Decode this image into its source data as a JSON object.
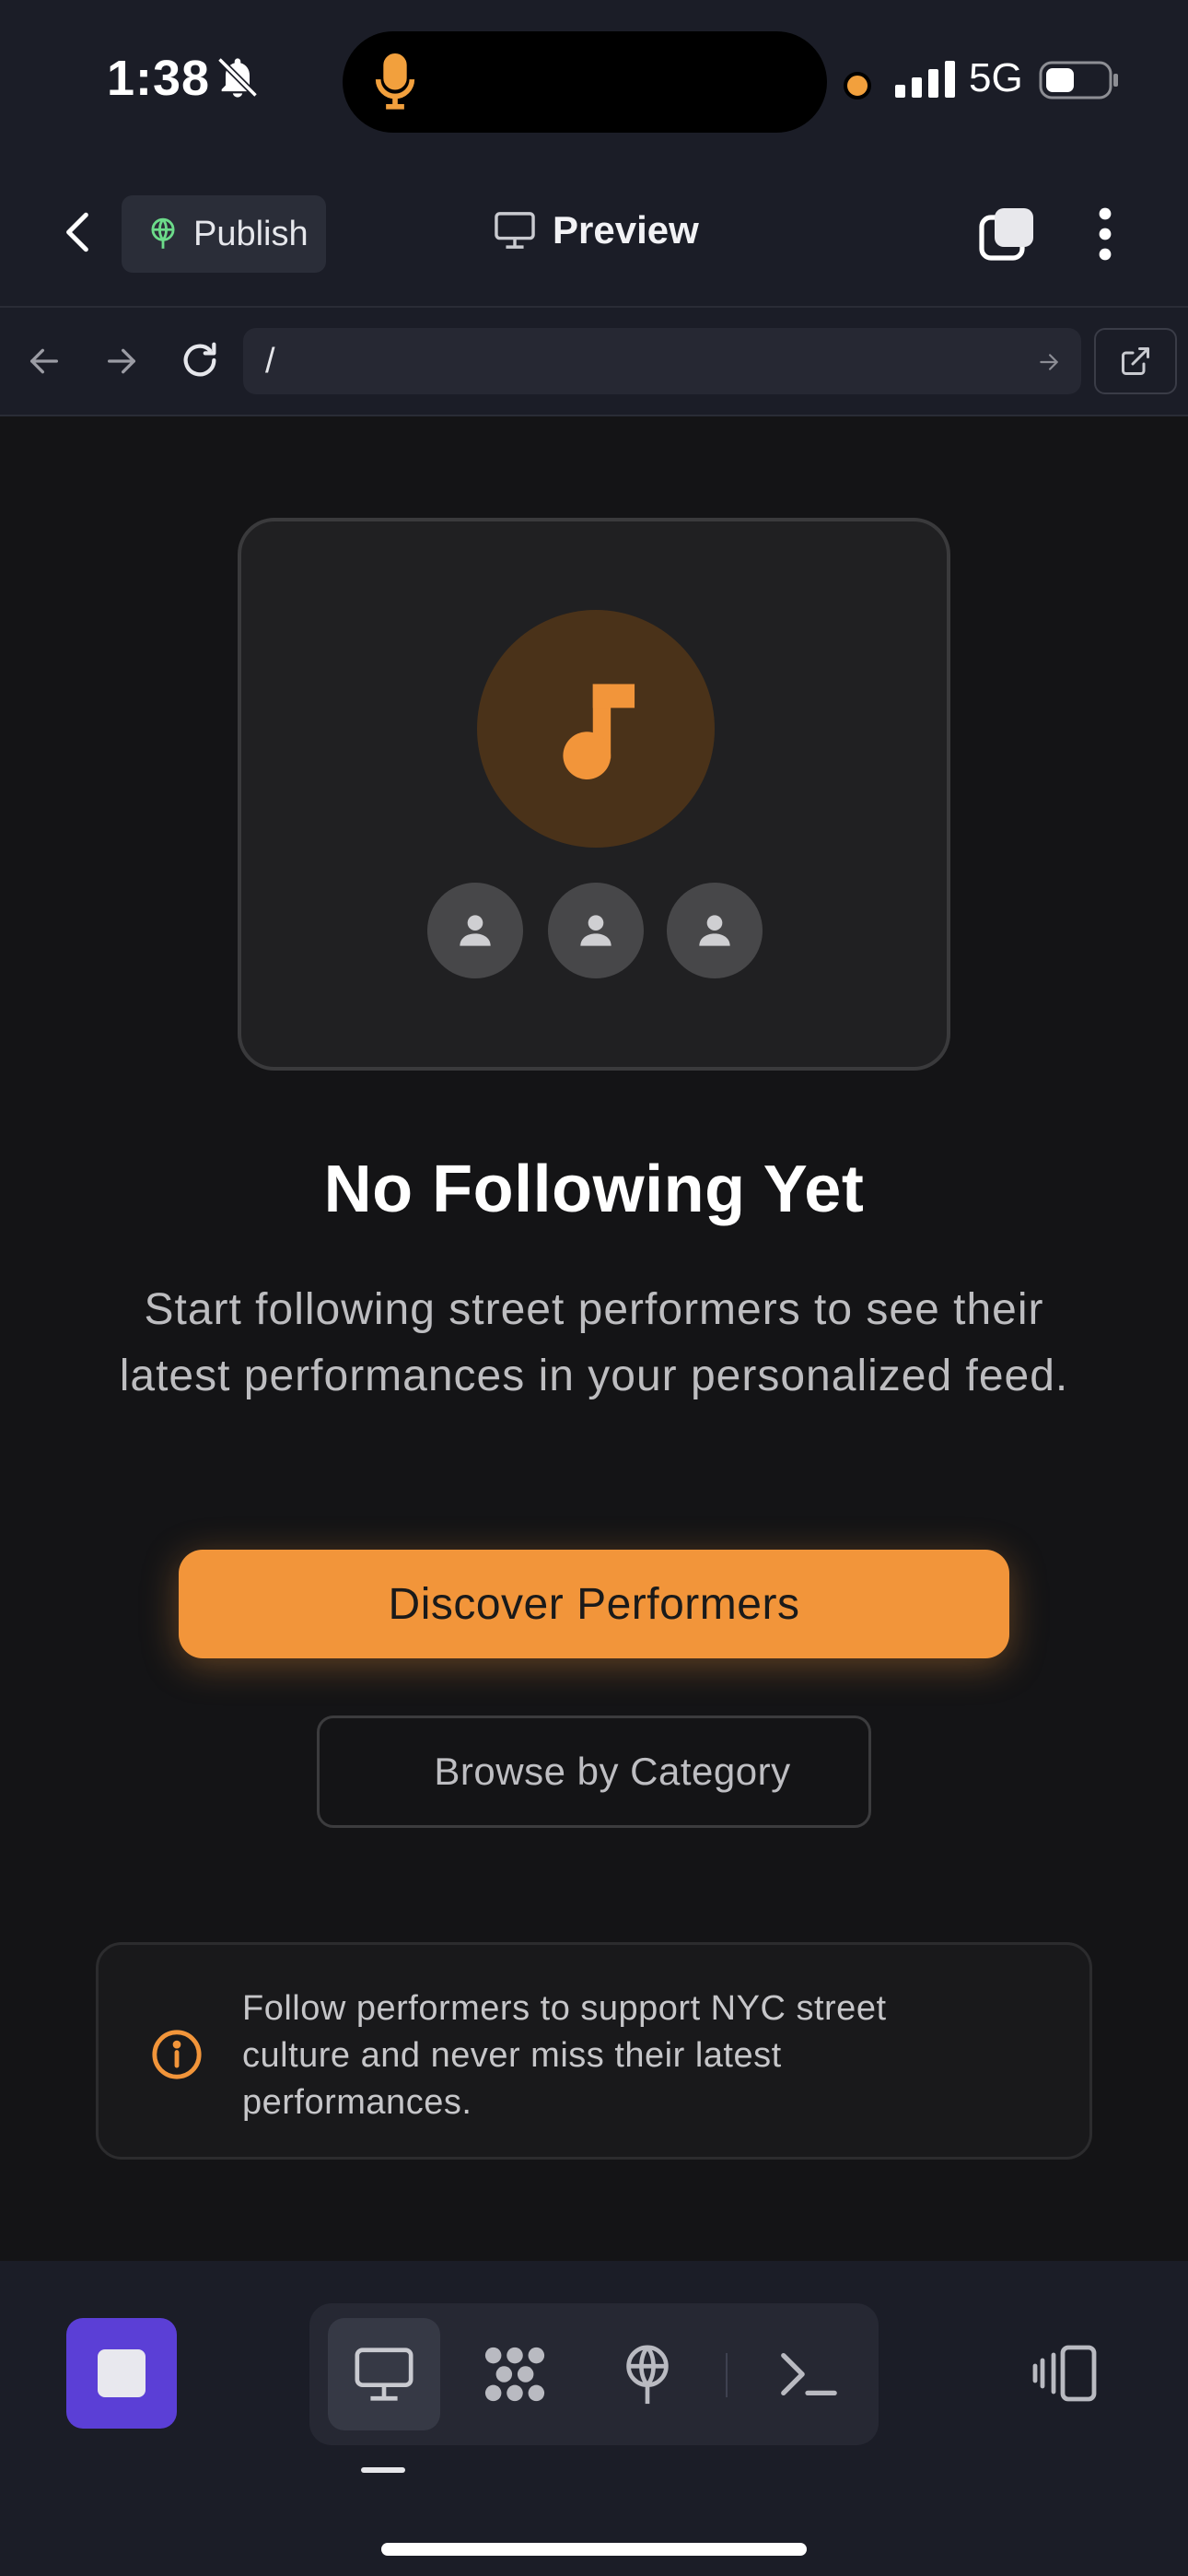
{
  "status_bar": {
    "time": "1:38",
    "network": "5G",
    "icons": [
      "bell-slash-icon",
      "microphone-icon",
      "signal-bars-icon",
      "battery-icon"
    ],
    "accent_dot_color": "#f2a03d"
  },
  "topbar": {
    "publish_label": "Publish",
    "preview_label": "Preview",
    "icons": [
      "chevron-left-icon",
      "globe-icon",
      "monitor-icon",
      "tabs-icon",
      "more-vertical-icon"
    ]
  },
  "urlbar": {
    "url": "/",
    "icons": [
      "arrow-left-icon",
      "arrow-right-icon",
      "reload-icon",
      "arrow-right-small-icon",
      "external-link-icon"
    ]
  },
  "empty_state": {
    "illustration_icons": [
      "music-note-icon",
      "user-icon",
      "user-icon",
      "user-icon"
    ],
    "title": "No Following Yet",
    "description": "Start following street performers to see their latest performances in your personalized feed.",
    "primary_button": "Discover Performers",
    "secondary_button": "Browse by Category",
    "info_text": "Follow performers to support NYC street culture and never miss their latest performances.",
    "accent_color": "#f2953a"
  },
  "bottom_toolbar": {
    "tools": [
      "monitor-icon",
      "dots-grid-icon",
      "deploy-icon",
      "terminal-icon"
    ],
    "active_tool": "monitor-icon",
    "stop_button_color": "#5b3fd6",
    "right_icon": "devices-icon"
  }
}
